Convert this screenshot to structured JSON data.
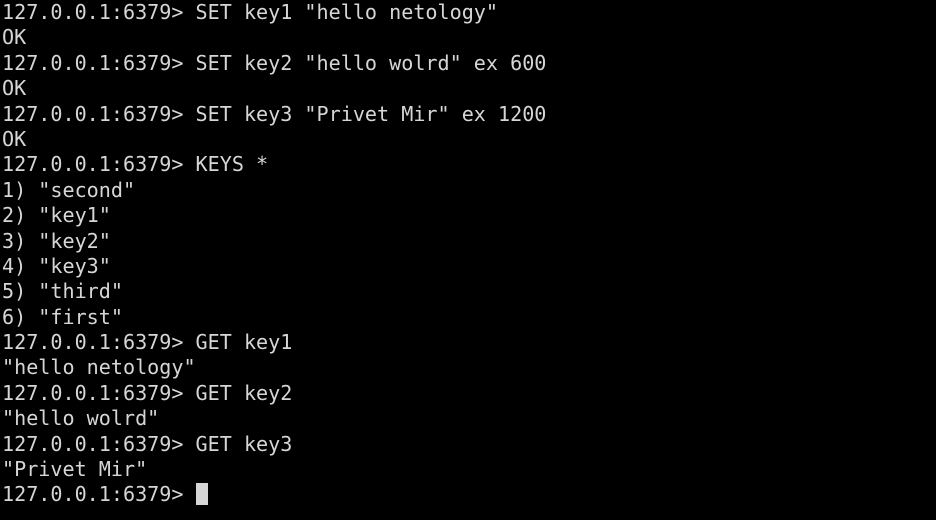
{
  "terminal": {
    "lines": [
      "127.0.0.1:6379> SET key1 \"hello netology\"",
      "OK",
      "127.0.0.1:6379> SET key2 \"hello wolrd\" ex 600",
      "OK",
      "127.0.0.1:6379> SET key3 \"Privet Mir\" ex 1200",
      "OK",
      "127.0.0.1:6379> KEYS *",
      "1) \"second\"",
      "2) \"key1\"",
      "3) \"key2\"",
      "4) \"key3\"",
      "5) \"third\"",
      "6) \"first\"",
      "127.0.0.1:6379> GET key1",
      "\"hello netology\"",
      "127.0.0.1:6379> GET key2",
      "\"hello wolrd\"",
      "127.0.0.1:6379> GET key3",
      "\"Privet Mir\""
    ],
    "prompt": "127.0.0.1:6379> ",
    "colors": {
      "background": "#000000",
      "foreground": "#d6d6d6",
      "cursor": "#d6d6d6"
    }
  }
}
